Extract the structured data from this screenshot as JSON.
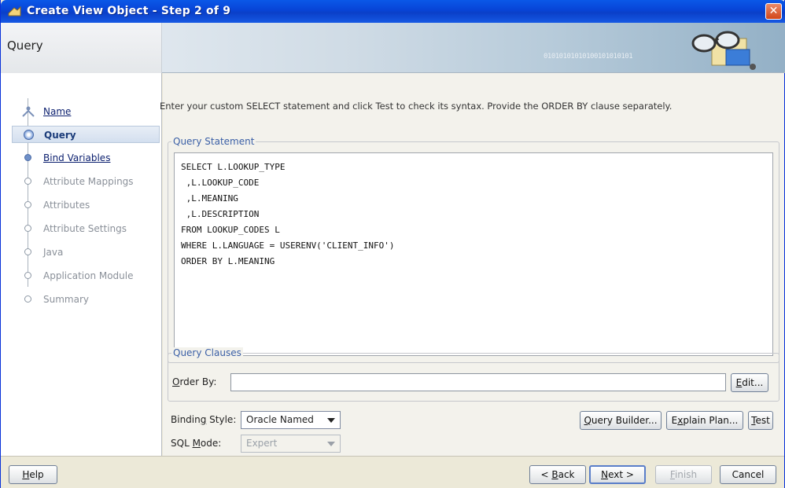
{
  "window": {
    "title": "Create View Object - Step 2 of 9",
    "close_glyph": "✕"
  },
  "banner": {
    "title": "Query",
    "bits": "01010101010100101010101"
  },
  "nav": {
    "items": [
      {
        "label": "Name",
        "state": "done"
      },
      {
        "label": "Query",
        "state": "current"
      },
      {
        "label": "Bind Variables",
        "state": "next"
      },
      {
        "label": "Attribute Mappings",
        "state": "disabled"
      },
      {
        "label": "Attributes",
        "state": "disabled"
      },
      {
        "label": "Attribute Settings",
        "state": "disabled"
      },
      {
        "label": "Java",
        "state": "disabled"
      },
      {
        "label": "Application Module",
        "state": "disabled"
      },
      {
        "label": "Summary",
        "state": "disabled"
      }
    ]
  },
  "main": {
    "instruction": "Enter your custom SELECT statement and click Test to check its syntax.  Provide the ORDER BY clause separately.",
    "query_statement_legend": "Query Statement",
    "sql_lines": [
      "SELECT L.LOOKUP_TYPE",
      " ,L.LOOKUP_CODE",
      " ,L.MEANING",
      " ,L.DESCRIPTION",
      "FROM LOOKUP_CODES L",
      "WHERE L.LANGUAGE = USERENV('CLIENT_INFO')",
      "ORDER BY L.MEANING"
    ],
    "query_clauses_legend": "Query Clauses",
    "order_by_label_mn": "O",
    "order_by_label_rest": "rder By:",
    "order_by_value": "",
    "edit_button_mn": "E",
    "edit_button_rest": "dit...",
    "binding_style_label_a": "Bindin",
    "binding_style_label_mn": "g",
    "binding_style_label_b": " Style:",
    "binding_style_value": "Oracle Named",
    "sql_mode_label_a": "SQL ",
    "sql_mode_label_mn": "M",
    "sql_mode_label_b": "ode:",
    "sql_mode_value": "Expert",
    "query_builder_mn": "Q",
    "query_builder_rest": "uery Builder...",
    "explain_plan_a": "E",
    "explain_plan_mn": "x",
    "explain_plan_rest": "plain Plan...",
    "test_mn": "T",
    "test_rest": "est"
  },
  "footer": {
    "help_mn": "H",
    "help_rest": "elp",
    "back_pre": "< ",
    "back_mn": "B",
    "back_rest": "ack",
    "next_mn": "N",
    "next_rest": "ext >",
    "finish_mn": "F",
    "finish_rest": "inish",
    "cancel_label": "Cancel"
  },
  "colors": {
    "titlebar": "#0a3fc8",
    "legend_text": "#3a5fa6",
    "nav_link": "#0a1e6e",
    "nav_disabled": "#8a9099"
  }
}
